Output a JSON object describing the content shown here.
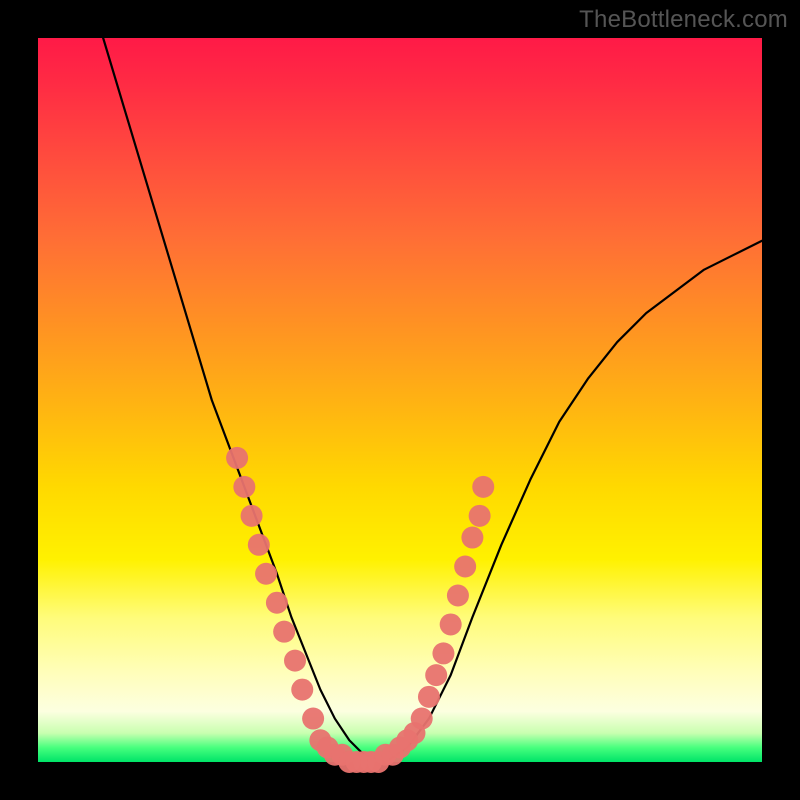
{
  "watermark": "TheBottleneck.com",
  "chart_data": {
    "type": "line",
    "title": "",
    "xlabel": "",
    "ylabel": "",
    "xlim": [
      0,
      100
    ],
    "ylim": [
      0,
      100
    ],
    "grid": false,
    "legend": false,
    "series": [
      {
        "name": "curve",
        "color": "#000000",
        "x": [
          9,
          12,
          15,
          18,
          21,
          24,
          27,
          30,
          33,
          35,
          37,
          39,
          41,
          43,
          45,
          48,
          51,
          54,
          57,
          60,
          64,
          68,
          72,
          76,
          80,
          84,
          88,
          92,
          96,
          100
        ],
        "y": [
          100,
          90,
          80,
          70,
          60,
          50,
          42,
          34,
          26,
          20,
          15,
          10,
          6,
          3,
          1,
          0,
          2,
          6,
          12,
          20,
          30,
          39,
          47,
          53,
          58,
          62,
          65,
          68,
          70,
          72
        ]
      },
      {
        "name": "dots-left",
        "color": "#e8736f",
        "style": "scatter",
        "x": [
          27.5,
          28.5,
          29.5,
          30.5,
          31.5,
          33.0,
          34.0,
          35.5,
          36.5,
          38.0
        ],
        "y": [
          42,
          38,
          34,
          30,
          26,
          22,
          18,
          14,
          10,
          6
        ]
      },
      {
        "name": "dots-bottom",
        "color": "#e8736f",
        "style": "scatter",
        "x": [
          39,
          40,
          41,
          42,
          43,
          44,
          45,
          46,
          47,
          48,
          49,
          50,
          51,
          52
        ],
        "y": [
          3,
          2,
          1,
          1,
          0,
          0,
          0,
          0,
          0,
          1,
          1,
          2,
          3,
          4
        ]
      },
      {
        "name": "dots-right",
        "color": "#e8736f",
        "style": "scatter",
        "x": [
          53,
          54,
          55,
          56,
          57,
          58,
          59,
          60,
          61
        ],
        "y": [
          6,
          9,
          12,
          15,
          19,
          23,
          27,
          31,
          34
        ]
      },
      {
        "name": "dot-outlier",
        "color": "#e8736f",
        "style": "scatter",
        "x": [
          61.5
        ],
        "y": [
          38
        ]
      }
    ]
  }
}
